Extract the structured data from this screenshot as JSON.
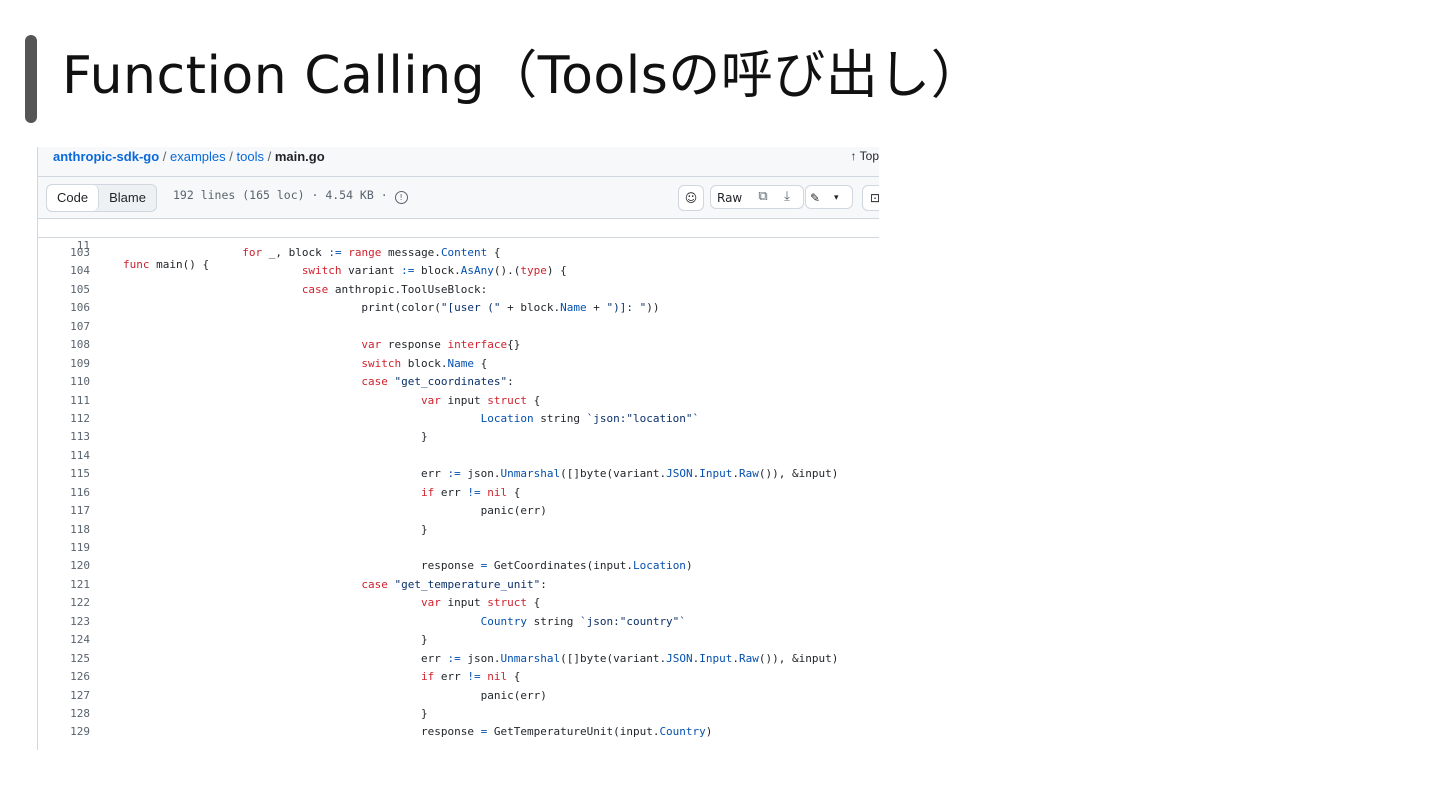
{
  "slide": {
    "title": "Function Calling（Toolsの呼び出し）"
  },
  "breadcrumb": {
    "repo": "anthropic-sdk-go",
    "dir1": "examples",
    "dir2": "tools",
    "file": "main.go",
    "sep": " / ",
    "top_label": "↑ Top"
  },
  "toolbar": {
    "code_tab": "Code",
    "blame_tab": "Blame",
    "file_info": "192 lines (165 loc) · 4.54 KB ·",
    "raw_label": "Raw",
    "icons": [
      "copilot-icon",
      "copy-icon",
      "download-icon",
      "edit-icon",
      "chevron-down-icon",
      "symbols-icon",
      "info-icon"
    ]
  },
  "sticky_line": {
    "number": "11",
    "text": "func main() {"
  },
  "code_lines": [
    {
      "n": "103",
      "t": "                  for _, block := range message.Content {"
    },
    {
      "n": "104",
      "t": "                           switch variant := block.AsAny().(type) {"
    },
    {
      "n": "105",
      "t": "                           case anthropic.ToolUseBlock:"
    },
    {
      "n": "106",
      "t": "                                    print(color(\"[user (\" + block.Name + \")]: \"))"
    },
    {
      "n": "107",
      "t": ""
    },
    {
      "n": "108",
      "t": "                                    var response interface{}"
    },
    {
      "n": "109",
      "t": "                                    switch block.Name {"
    },
    {
      "n": "110",
      "t": "                                    case \"get_coordinates\":"
    },
    {
      "n": "111",
      "t": "                                             var input struct {"
    },
    {
      "n": "112",
      "t": "                                                      Location string `json:\"location\"`"
    },
    {
      "n": "113",
      "t": "                                             }"
    },
    {
      "n": "114",
      "t": ""
    },
    {
      "n": "115",
      "t": "                                             err := json.Unmarshal([]byte(variant.JSON.Input.Raw()), &input)"
    },
    {
      "n": "116",
      "t": "                                             if err != nil {"
    },
    {
      "n": "117",
      "t": "                                                      panic(err)"
    },
    {
      "n": "118",
      "t": "                                             }"
    },
    {
      "n": "119",
      "t": ""
    },
    {
      "n": "120",
      "t": "                                             response = GetCoordinates(input.Location)"
    },
    {
      "n": "121",
      "t": "                                    case \"get_temperature_unit\":"
    },
    {
      "n": "122",
      "t": "                                             var input struct {"
    },
    {
      "n": "123",
      "t": "                                                      Country string `json:\"country\"`"
    },
    {
      "n": "124",
      "t": "                                             }"
    },
    {
      "n": "125",
      "t": "                                             err := json.Unmarshal([]byte(variant.JSON.Input.Raw()), &input)"
    },
    {
      "n": "126",
      "t": "                                             if err != nil {"
    },
    {
      "n": "127",
      "t": "                                                      panic(err)"
    },
    {
      "n": "128",
      "t": "                                             }"
    },
    {
      "n": "129",
      "t": "                                             response = GetTemperatureUnit(input.Country)"
    }
  ],
  "colors": {
    "keyword": "#cf222e",
    "function": "#0550ae",
    "string": "#0a3069",
    "link": "#0969da",
    "line_number": "#59636e",
    "title_bar": "#555555"
  }
}
